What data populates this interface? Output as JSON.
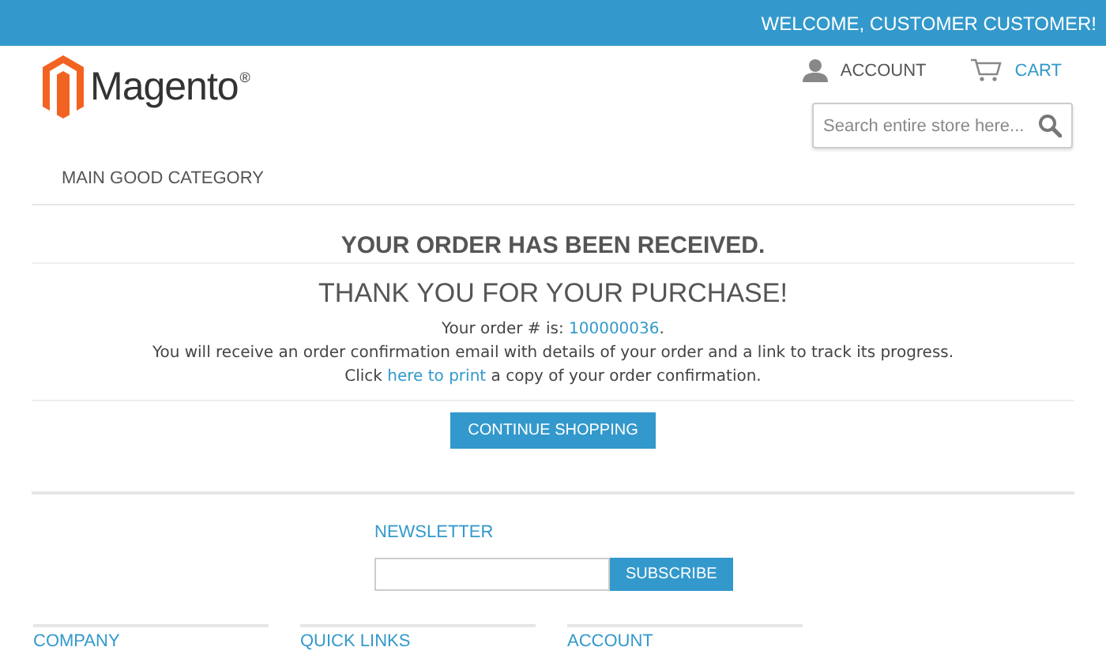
{
  "top_bar": {
    "welcome": "WELCOME, CUSTOMER CUSTOMER!"
  },
  "header": {
    "logo_text": "Magento",
    "logo_mark": "®",
    "account": "ACCOUNT",
    "cart": "CART",
    "search": {
      "placeholder": "Search entire store here..."
    }
  },
  "nav": {
    "items": [
      "MAIN GOOD CATEGORY"
    ]
  },
  "success": {
    "title": "YOUR ORDER HAS BEEN RECEIVED.",
    "subtitle": "THANK YOU FOR YOUR PURCHASE!",
    "order_line": {
      "prefix": "Your order # is: ",
      "number": "100000036",
      "suffix": "."
    },
    "email_line": "You will receive an order confirmation email with details of your order and a link to track its progress.",
    "print_line": {
      "prefix": "Click ",
      "link": "here to print",
      "suffix": " a copy of your order confirmation."
    },
    "button": "CONTINUE SHOPPING"
  },
  "footer": {
    "newsletter": {
      "title": "NEWSLETTER",
      "button": "SUBSCRIBE"
    },
    "columns": [
      "COMPANY",
      "QUICK LINKS",
      "ACCOUNT"
    ]
  }
}
